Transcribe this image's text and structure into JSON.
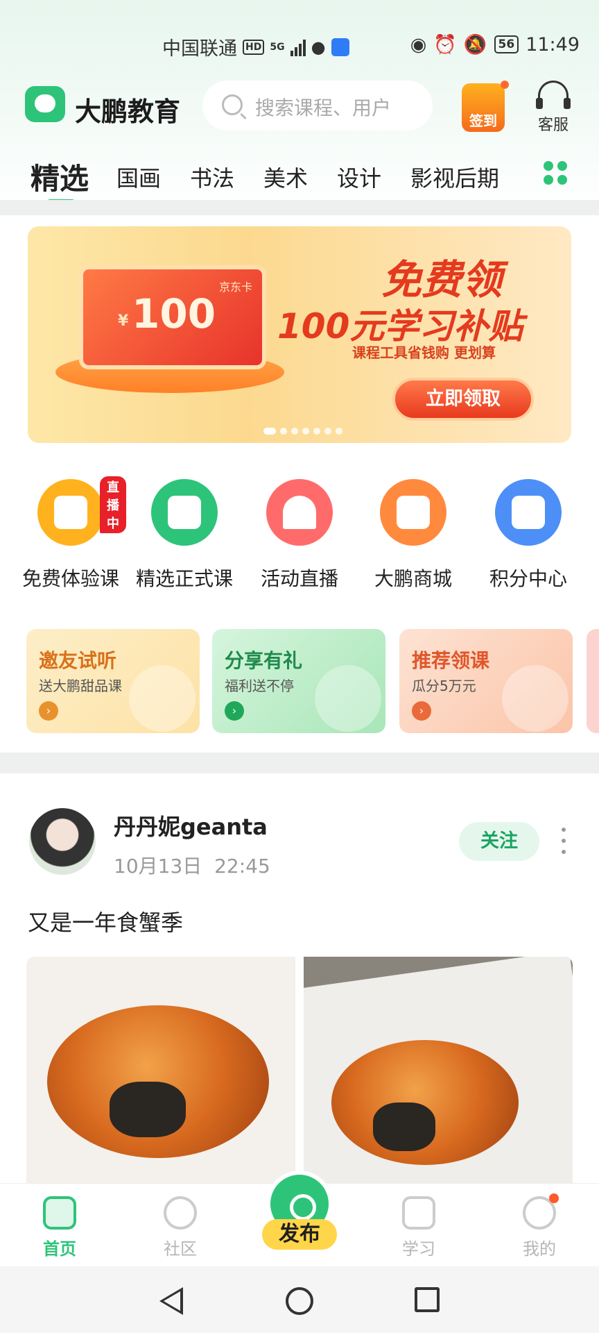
{
  "status_bar": {
    "carrier": "中国联通",
    "hd": "HD",
    "network": "5G",
    "battery": "56",
    "time": "11:49"
  },
  "header": {
    "brand": "大鹏教育",
    "search_placeholder": "搜索课程、用户",
    "signin_label": "签到",
    "service_label": "客服"
  },
  "tabs": [
    "精选",
    "国画",
    "书法",
    "美术",
    "设计",
    "影视后期"
  ],
  "banner": {
    "card_label": "京东卡",
    "card_currency": "¥",
    "card_amount": "100",
    "title": "免费领",
    "subtitle": "100元学习补贴",
    "tagline": "课程工具省钱购 更划算",
    "button": "立即领取",
    "slide_count": 7,
    "active_slide": 1
  },
  "quick_icons": [
    {
      "label": "免费体验课",
      "icon": "video-icon",
      "color": "#ffb21e",
      "badge": "直播中"
    },
    {
      "label": "精选正式课",
      "icon": "tv-play-icon",
      "color": "#2dc47a"
    },
    {
      "label": "活动直播",
      "icon": "fan-icon",
      "color": "#ff6b6b"
    },
    {
      "label": "大鹏商城",
      "icon": "shop-icon",
      "color": "#ff8a3d"
    },
    {
      "label": "积分中心",
      "icon": "gift-icon",
      "color": "#4d8ff7"
    }
  ],
  "promos": [
    {
      "title": "邀友试听",
      "subtitle": "送大鹏甜品课",
      "color": "#d9711a",
      "bg": "#fdeec8",
      "icon": "gift-box-icon"
    },
    {
      "title": "分享有礼",
      "subtitle": "福利送不停",
      "color": "#1f8a4c",
      "bg": "#c9f0d3",
      "icon": "smile-chat-icon"
    },
    {
      "title": "推荐领课",
      "subtitle": "瓜分5万元",
      "color": "#e0562a",
      "bg": "#fdd9c6",
      "icon": "yuan-coin-icon"
    }
  ],
  "post": {
    "username": "丹丹妮geanta",
    "date": "10月13日",
    "time": "22:45",
    "follow_label": "关注",
    "text": "又是一年食蟹季"
  },
  "bottom_nav": [
    {
      "label": "首页",
      "icon": "home-icon",
      "active": true
    },
    {
      "label": "社区",
      "icon": "planet-icon",
      "active": false
    },
    {
      "label": "发布",
      "icon": "camera-icon",
      "active": false
    },
    {
      "label": "学习",
      "icon": "book-icon",
      "active": false
    },
    {
      "label": "我的",
      "icon": "smile-face-icon",
      "active": false
    }
  ],
  "colors": {
    "accent": "#2dc47a",
    "banner_red": "#e43a1e"
  }
}
